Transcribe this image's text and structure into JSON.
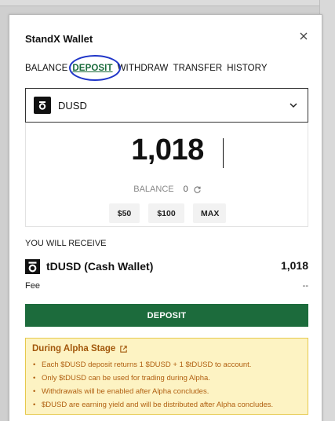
{
  "modal": {
    "title": "StandX Wallet",
    "close_glyph": "×"
  },
  "tabs": [
    {
      "label": "BALANCE",
      "active": false
    },
    {
      "label": "DEPOSIT",
      "active": true
    },
    {
      "label": "WITHDRAW",
      "active": false
    },
    {
      "label": "TRANSFER",
      "active": false
    },
    {
      "label": "HISTORY",
      "active": false
    }
  ],
  "token_selector": {
    "label": "DUSD",
    "icon": "standx-logo-icon"
  },
  "amount": {
    "value": "1,018",
    "balance_label": "BALANCE",
    "balance_value": "0"
  },
  "quick_amounts": [
    "$50",
    "$100",
    "MAX"
  ],
  "receive": {
    "label": "YOU WILL RECEIVE",
    "token": "tDUSD (Cash Wallet)",
    "amount": "1,018"
  },
  "fee": {
    "label": "Fee",
    "value": "--"
  },
  "deposit_button": "DEPOSIT",
  "notice": {
    "title": "During Alpha Stage",
    "items": [
      "Each $DUSD deposit returns 1 $DUSD + 1 $tDUSD to account.",
      "Only $tDUSD can be used for trading during Alpha.",
      "Withdrawals will be enabled after Alpha concludes.",
      "$DUSD are earning yield and will be distributed after Alpha concludes."
    ]
  },
  "colors": {
    "accent_green": "#1c6b3c",
    "highlight_circle": "#1f35c8",
    "notice_bg": "#fdf3c3",
    "notice_text": "#b05f10"
  }
}
